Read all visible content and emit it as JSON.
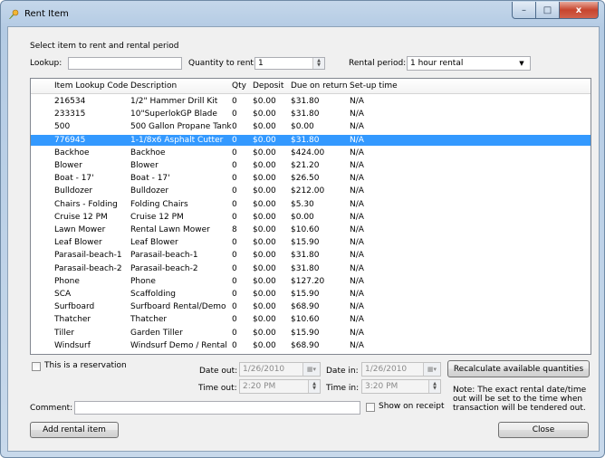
{
  "window": {
    "title": "Rent Item",
    "close_glyph": "x",
    "min_glyph": "–",
    "max_glyph": "□"
  },
  "group": {
    "label": "Select item to rent and rental period"
  },
  "lookup": {
    "label": "Lookup:",
    "value": ""
  },
  "quantity": {
    "label": "Quantity to rent:",
    "value": "1"
  },
  "rental_period": {
    "label": "Rental period:",
    "value": "1 hour rental"
  },
  "table": {
    "columns": [
      "Item Lookup Code",
      "Description",
      "Qty",
      "Deposit",
      "Due on return",
      "Set-up time"
    ],
    "selected_index": 3,
    "rows": [
      [
        "216534",
        "1/2\" Hammer Drill Kit",
        "0",
        "$0.00",
        "$31.80",
        "N/A"
      ],
      [
        "233315",
        "10\"SuperlokGP Blade",
        "0",
        "$0.00",
        "$31.80",
        "N/A"
      ],
      [
        "500",
        "500 Gallon Propane Tank",
        "0",
        "$0.00",
        "$0.00",
        "N/A"
      ],
      [
        "776945",
        "1-1/8x6 Asphalt Cutter",
        "0",
        "$0.00",
        "$31.80",
        "N/A"
      ],
      [
        "Backhoe",
        "Backhoe",
        "0",
        "$0.00",
        "$424.00",
        "N/A"
      ],
      [
        "Blower",
        "Blower",
        "0",
        "$0.00",
        "$21.20",
        "N/A"
      ],
      [
        "Boat - 17'",
        "Boat - 17'",
        "0",
        "$0.00",
        "$26.50",
        "N/A"
      ],
      [
        "Bulldozer",
        "Bulldozer",
        "0",
        "$0.00",
        "$212.00",
        "N/A"
      ],
      [
        "Chairs - Folding",
        "Folding Chairs",
        "0",
        "$0.00",
        "$5.30",
        "N/A"
      ],
      [
        "Cruise 12 PM",
        "Cruise 12 PM",
        "0",
        "$0.00",
        "$0.00",
        "N/A"
      ],
      [
        "Lawn Mower",
        "Rental Lawn Mower",
        "8",
        "$0.00",
        "$10.60",
        "N/A"
      ],
      [
        "Leaf Blower",
        "Leaf Blower",
        "0",
        "$0.00",
        "$15.90",
        "N/A"
      ],
      [
        "Parasail-beach-1",
        "Parasail-beach-1",
        "0",
        "$0.00",
        "$31.80",
        "N/A"
      ],
      [
        "Parasail-beach-2",
        "Parasail-beach-2",
        "0",
        "$0.00",
        "$31.80",
        "N/A"
      ],
      [
        "Phone",
        "Phone",
        "0",
        "$0.00",
        "$127.20",
        "N/A"
      ],
      [
        "SCA",
        "Scaffolding",
        "0",
        "$0.00",
        "$15.90",
        "N/A"
      ],
      [
        "Surfboard",
        "Surfboard Rental/Demo",
        "0",
        "$0.00",
        "$68.90",
        "N/A"
      ],
      [
        "Thatcher",
        "Thatcher",
        "0",
        "$0.00",
        "$10.60",
        "N/A"
      ],
      [
        "Tiller",
        "Garden Tiller",
        "0",
        "$0.00",
        "$15.90",
        "N/A"
      ],
      [
        "Windsurf",
        "Windsurf Demo / Rental",
        "0",
        "$0.00",
        "$68.90",
        "N/A"
      ]
    ]
  },
  "reservation": {
    "label": "This is a reservation",
    "checked": false
  },
  "date_out": {
    "label": "Date out:",
    "value": "1/26/2010"
  },
  "date_in": {
    "label": "Date in:",
    "value": "1/26/2010"
  },
  "time_out": {
    "label": "Time out:",
    "value": "2:20 PM"
  },
  "time_in": {
    "label": "Time in:",
    "value": "3:20 PM"
  },
  "recalc_button": "Recalculate available quantities",
  "comment": {
    "label": "Comment:",
    "value": ""
  },
  "show_on_receipt": {
    "label": "Show on receipt",
    "checked": false
  },
  "note": "Note: The exact rental date/time out will be set to the time when transaction will be tendered out.",
  "add_button": "Add rental item",
  "close_button": "Close",
  "colors": {
    "selection": "#3399ff",
    "frame": "#b4cbe4"
  }
}
